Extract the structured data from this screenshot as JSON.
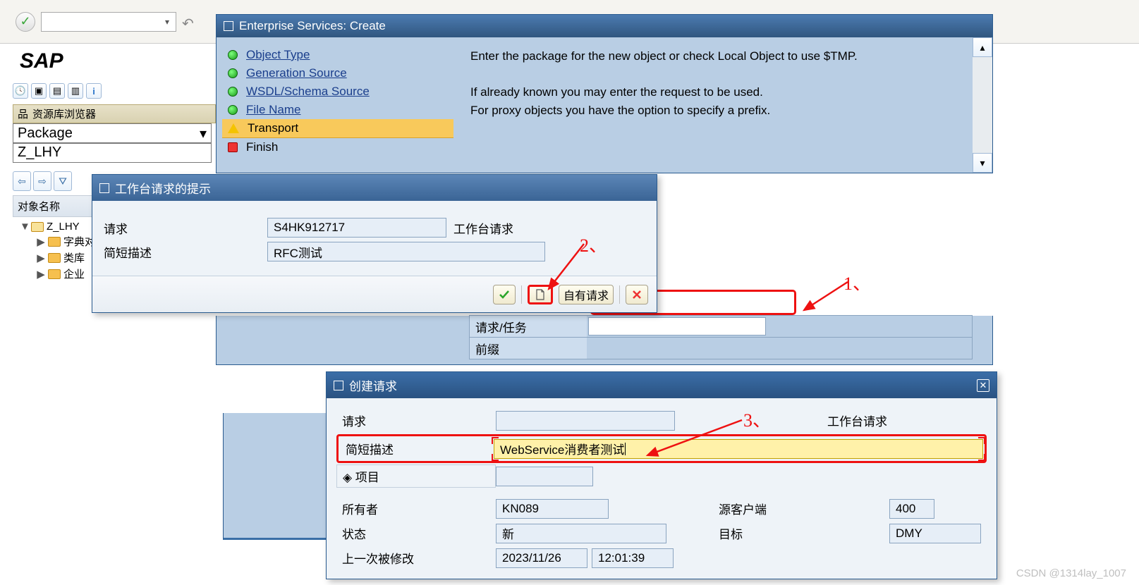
{
  "toolbar": {
    "combo": "",
    "ok_icon": "✓"
  },
  "left": {
    "logo": "SAP",
    "panel_title": "资源库浏览器",
    "combo_value": "Package",
    "input_value": "Z_LHY",
    "tree_header": "对象名称",
    "tree": {
      "root": "Z_LHY",
      "c1": "字典对",
      "c2": "类库",
      "c3": "企业"
    }
  },
  "es": {
    "title": "Enterprise Services: Create",
    "steps": {
      "s1": "Object Type",
      "s2": "Generation Source",
      "s3": "WSDL/Schema Source",
      "s4": "File Name",
      "s5": "Transport",
      "s6": "Finish"
    },
    "info_l1": "Enter the package for the new object or check Local Object to use $TMP.",
    "info_l2": "If already known you may enter the request to be used.",
    "info_l3": "For proxy objects you have the option to specify a prefix.",
    "field_req": "请求/任务",
    "field_prefix": "前缀"
  },
  "wb": {
    "title": "工作台请求的提示",
    "lbl_request": "请求",
    "val_request": "S4HK912717",
    "lbl_wbreq": "工作台请求",
    "lbl_desc": "简短描述",
    "val_desc": "RFC测试",
    "btn_own": "自有请求"
  },
  "cr": {
    "title": "创建请求",
    "lbl_request": "请求",
    "lbl_wbreq": "工作台请求",
    "lbl_desc": "简短描述",
    "val_desc": "WebService消费者测试",
    "lbl_project": "项目",
    "lbl_owner": "所有者",
    "val_owner": "KN089",
    "lbl_srcclient": "源客户端",
    "val_srcclient": "400",
    "lbl_status": "状态",
    "val_status": "新",
    "lbl_target": "目标",
    "val_target": "DMY",
    "lbl_lastmod": "上一次被修改",
    "val_date": "2023/11/26",
    "val_time": "12:01:39"
  },
  "anno": {
    "a1": "1、",
    "a2": "2、",
    "a3": "3、"
  },
  "watermark": "CSDN @1314lay_1007"
}
